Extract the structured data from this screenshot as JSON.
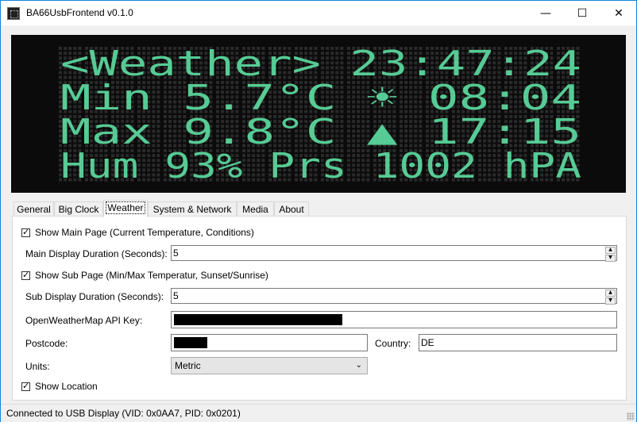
{
  "window": {
    "title": "BA66UsbFrontend v0.1.0",
    "minimize": "—",
    "maximize": "☐",
    "close": "✕"
  },
  "display": {
    "rows": [
      "<Weather>   23:47:24",
      "Min   5.7°C  ☀ 08:04",
      "Max   9.8°C  ▲ 17:15",
      "Hum 93% Prs 1002 hPA"
    ],
    "on_color": "#5cdba0",
    "off_color": "#2a2a2a"
  },
  "tabs": [
    {
      "label": "General"
    },
    {
      "label": "Big Clock"
    },
    {
      "label": "Weather"
    },
    {
      "label": "System & Network"
    },
    {
      "label": "Media"
    },
    {
      "label": "About"
    }
  ],
  "weather": {
    "show_main_label": "Show Main Page (Current Temperature, Conditions)",
    "show_main_checked": true,
    "main_duration_label": "Main Display Duration (Seconds):",
    "main_duration_value": "5",
    "show_sub_label": "Show Sub Page (Min/Max Temperatur, Sunset/Sunrise)",
    "show_sub_checked": true,
    "sub_duration_label": "Sub Display Duration (Seconds):",
    "sub_duration_value": "5",
    "api_key_label": "OpenWeatherMap API Key:",
    "postcode_label": "Postcode:",
    "country_label": "Country:",
    "country_value": "DE",
    "units_label": "Units:",
    "units_value": "Metric",
    "show_location_label": "Show Location",
    "show_location_checked": true
  },
  "status": {
    "text": "Connected to USB Display (VID: 0x0AA7, PID: 0x0201)"
  }
}
